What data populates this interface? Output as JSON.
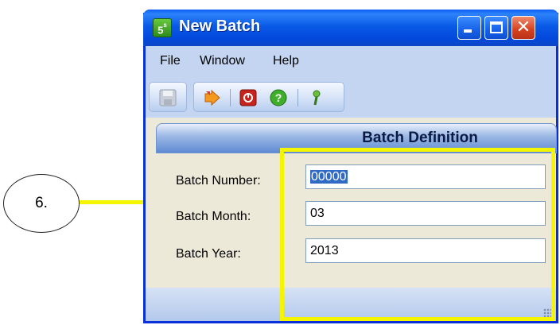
{
  "callout": {
    "label": "6.",
    "highlight_color": "#f5f500"
  },
  "window": {
    "title": "New Batch",
    "app_icon_text": "5",
    "app_icon_sub": "s",
    "buttons": {
      "minimize": "minimize-icon",
      "maximize": "maximize-icon",
      "close": "close-icon"
    }
  },
  "menu": {
    "items": [
      "File",
      "Window",
      "Help"
    ]
  },
  "toolbar": {
    "icons": [
      "save-icon",
      "arrow-icon",
      "stop-icon",
      "help-icon",
      "key-icon"
    ]
  },
  "section": {
    "title": "Batch Definition"
  },
  "fields": [
    {
      "label": "Batch Number:",
      "value": "00000"
    },
    {
      "label": "Batch Month:",
      "value": "03"
    },
    {
      "label": "Batch Year:",
      "value": "2013"
    }
  ],
  "colors": {
    "accent": "#0a5ae6",
    "menu_bg": "#c3d5f1",
    "body_bg": "#ece9d8"
  }
}
